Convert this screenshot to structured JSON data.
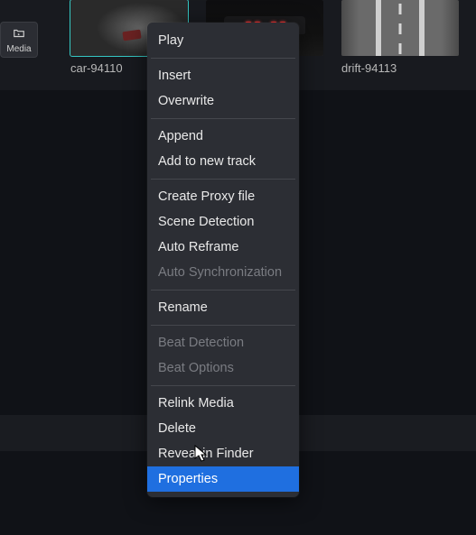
{
  "toolbar": {
    "media_label": "Media"
  },
  "thumbnails": [
    {
      "label": "car-94110",
      "selected": true
    },
    {
      "label": "",
      "selected": false
    },
    {
      "label": "drift-94113",
      "selected": false
    }
  ],
  "context_menu": {
    "items": [
      {
        "label": "Play",
        "kind": "item",
        "enabled": true,
        "highlight": false
      },
      {
        "kind": "sep"
      },
      {
        "label": "Insert",
        "kind": "item",
        "enabled": true,
        "highlight": false
      },
      {
        "label": "Overwrite",
        "kind": "item",
        "enabled": true,
        "highlight": false
      },
      {
        "kind": "sep"
      },
      {
        "label": "Append",
        "kind": "item",
        "enabled": true,
        "highlight": false
      },
      {
        "label": "Add to new track",
        "kind": "item",
        "enabled": true,
        "highlight": false
      },
      {
        "kind": "sep"
      },
      {
        "label": "Create Proxy file",
        "kind": "item",
        "enabled": true,
        "highlight": false
      },
      {
        "label": "Scene Detection",
        "kind": "item",
        "enabled": true,
        "highlight": false
      },
      {
        "label": "Auto Reframe",
        "kind": "item",
        "enabled": true,
        "highlight": false
      },
      {
        "label": "Auto Synchronization",
        "kind": "item",
        "enabled": false,
        "highlight": false
      },
      {
        "kind": "sep"
      },
      {
        "label": "Rename",
        "kind": "item",
        "enabled": true,
        "highlight": false
      },
      {
        "kind": "sep"
      },
      {
        "label": "Beat Detection",
        "kind": "item",
        "enabled": false,
        "highlight": false
      },
      {
        "label": "Beat Options",
        "kind": "item",
        "enabled": false,
        "highlight": false
      },
      {
        "kind": "sep"
      },
      {
        "label": "Relink Media",
        "kind": "item",
        "enabled": true,
        "highlight": false
      },
      {
        "label": "Delete",
        "kind": "item",
        "enabled": true,
        "highlight": false
      },
      {
        "label": "Reveal in Finder",
        "kind": "item",
        "enabled": true,
        "highlight": false
      },
      {
        "label": "Properties",
        "kind": "item",
        "enabled": true,
        "highlight": true
      }
    ]
  }
}
